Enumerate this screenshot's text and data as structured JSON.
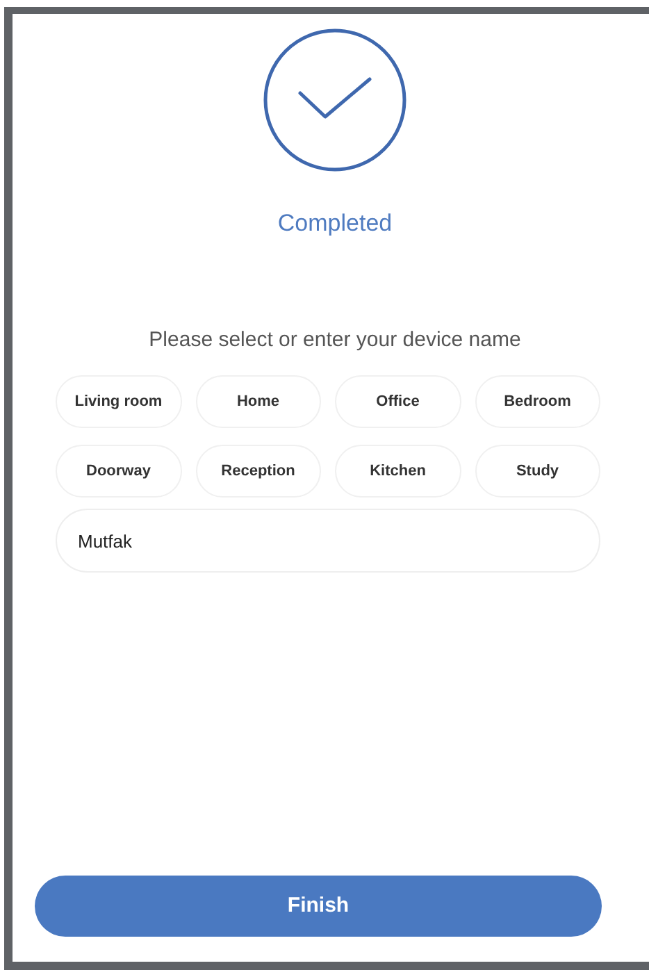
{
  "status": {
    "title": "Completed"
  },
  "prompt": "Please select or enter your device name",
  "name_options": [
    "Living room",
    "Home",
    "Office",
    "Bedroom",
    "Doorway",
    "Reception",
    "Kitchen",
    "Study"
  ],
  "name_field": {
    "value": "Mutfak"
  },
  "finish_button": {
    "label": "Finish"
  }
}
